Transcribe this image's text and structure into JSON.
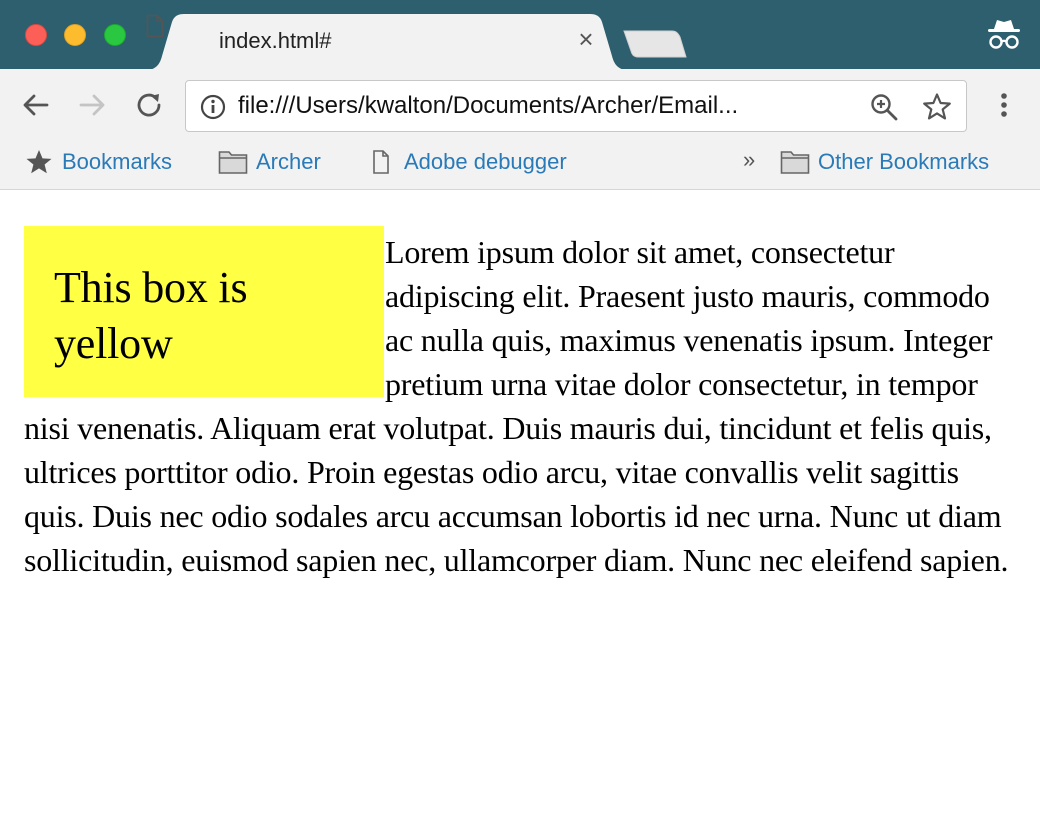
{
  "window": {
    "controls": [
      "close",
      "minimize",
      "zoom"
    ]
  },
  "tab": {
    "title": "index.html#",
    "close_label": "×",
    "icon": "file-icon"
  },
  "toolbar": {
    "back_icon": "back-arrow-icon",
    "forward_icon": "forward-arrow-icon",
    "reload_icon": "reload-icon",
    "menu_icon": "kebab-menu-icon"
  },
  "omnibox": {
    "url": "file:///Users/kwalton/Documents/Archer/Email...",
    "info_icon": "info-icon",
    "zoom_icon": "zoom-icon",
    "star_icon": "star-icon"
  },
  "bookmarks": {
    "items": [
      {
        "label": "Bookmarks",
        "icon": "star-icon"
      },
      {
        "label": "Archer",
        "icon": "folder-icon"
      },
      {
        "label": "Adobe debugger",
        "icon": "file-icon"
      }
    ],
    "overflow": "»",
    "other": {
      "label": "Other Bookmarks",
      "icon": "folder-icon"
    }
  },
  "page": {
    "box_text": "This box is yellow",
    "paragraph": "Lorem ipsum dolor sit amet, consectetur adipiscing elit. Praesent justo mauris, commodo ac nulla quis, maximus venenatis ipsum. Integer pretium urna vitae dolor consectetur, in tempor nisi venenatis. Aliquam erat volutpat. Duis mauris dui, tincidunt et felis quis, ultrices porttitor odio. Proin egestas odio arcu, vitae convallis velit sagittis quis. Duis nec odio sodales arcu accumsan lobortis id nec urna. Nunc ut diam sollicitudin, euismod sapien nec, ullamcorper diam. Nunc nec eleifend sapien."
  },
  "colors": {
    "titlebar": "#2e5f6e",
    "box_background": "#ffff44",
    "bookmark_link": "#2a7ab8"
  }
}
